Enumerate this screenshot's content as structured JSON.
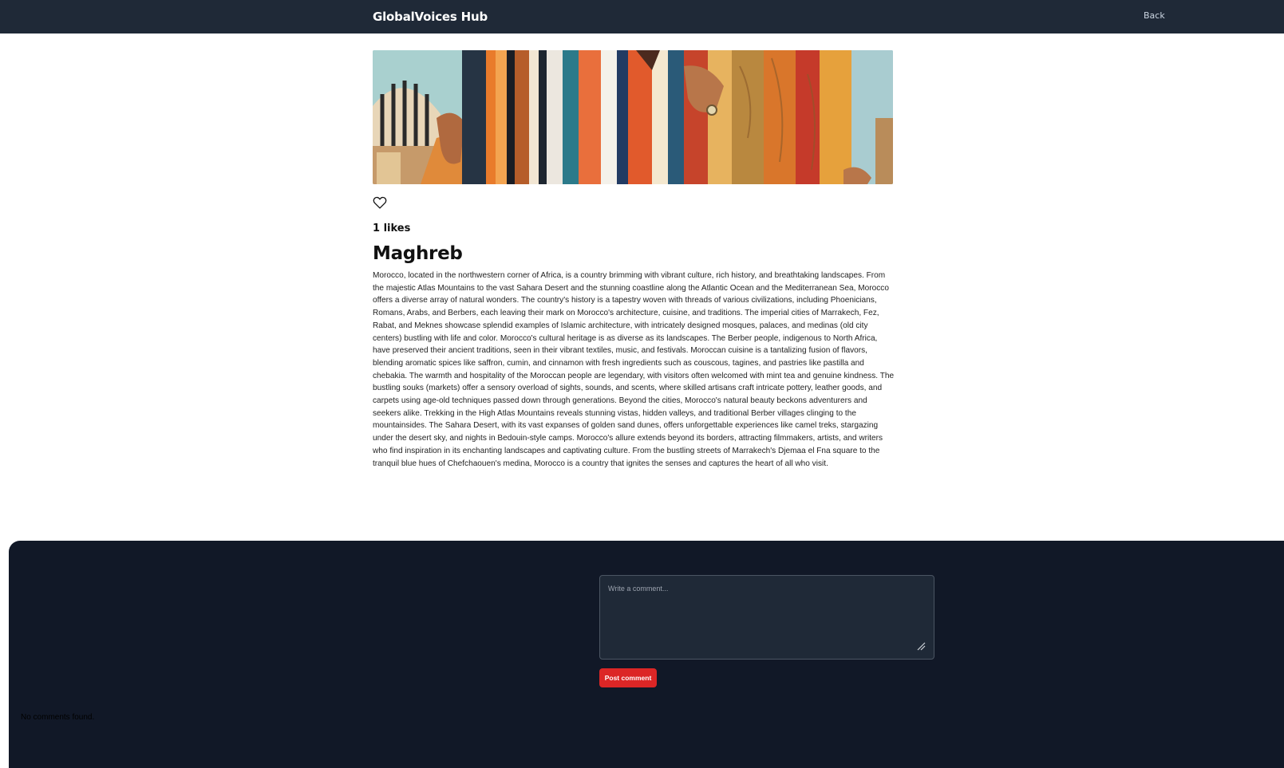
{
  "header": {
    "brand": "GlobalVoices Hub",
    "back_label": "Back"
  },
  "post": {
    "hero_icon": "cultural-banner-image",
    "like_icon": "heart-outline-icon",
    "likes": "1 likes",
    "title": "Maghreb",
    "body": "Morocco, located in the northwestern corner of Africa, is a country brimming with vibrant culture, rich history, and breathtaking landscapes. From the majestic Atlas Mountains to the vast Sahara Desert and the stunning coastline along the Atlantic Ocean and the Mediterranean Sea, Morocco offers a diverse array of natural wonders. The country's history is a tapestry woven with threads of various civilizations, including Phoenicians, Romans, Arabs, and Berbers, each leaving their mark on Morocco's architecture, cuisine, and traditions. The imperial cities of Marrakech, Fez, Rabat, and Meknes showcase splendid examples of Islamic architecture, with intricately designed mosques, palaces, and medinas (old city centers) bustling with life and color. Morocco's cultural heritage is as diverse as its landscapes. The Berber people, indigenous to North Africa, have preserved their ancient traditions, seen in their vibrant textiles, music, and festivals. Moroccan cuisine is a tantalizing fusion of flavors, blending aromatic spices like saffron, cumin, and cinnamon with fresh ingredients such as couscous, tagines, and pastries like pastilla and chebakia. The warmth and hospitality of the Moroccan people are legendary, with visitors often welcomed with mint tea and genuine kindness. The bustling souks (markets) offer a sensory overload of sights, sounds, and scents, where skilled artisans craft intricate pottery, leather goods, and carpets using age-old techniques passed down through generations. Beyond the cities, Morocco's natural beauty beckons adventurers and seekers alike. Trekking in the High Atlas Mountains reveals stunning vistas, hidden valleys, and traditional Berber villages clinging to the mountainsides. The Sahara Desert, with its vast expanses of golden sand dunes, offers unforgettable experiences like camel treks, stargazing under the desert sky, and nights in Bedouin-style camps. Morocco's allure extends beyond its borders, attracting filmmakers, artists, and writers who find inspiration in its enchanting landscapes and captivating culture. From the bustling streets of Marrakech's Djemaa el Fna square to the tranquil blue hues of Chefchaouen's medina, Morocco is a country that ignites the senses and captures the heart of all who visit."
  },
  "comments": {
    "placeholder": "Write a comment...",
    "submit_label": "Post comment",
    "empty_message": "No comments found."
  },
  "colors": {
    "navbar": "#1f2937",
    "panel": "#111827",
    "accent": "#dc2626"
  }
}
